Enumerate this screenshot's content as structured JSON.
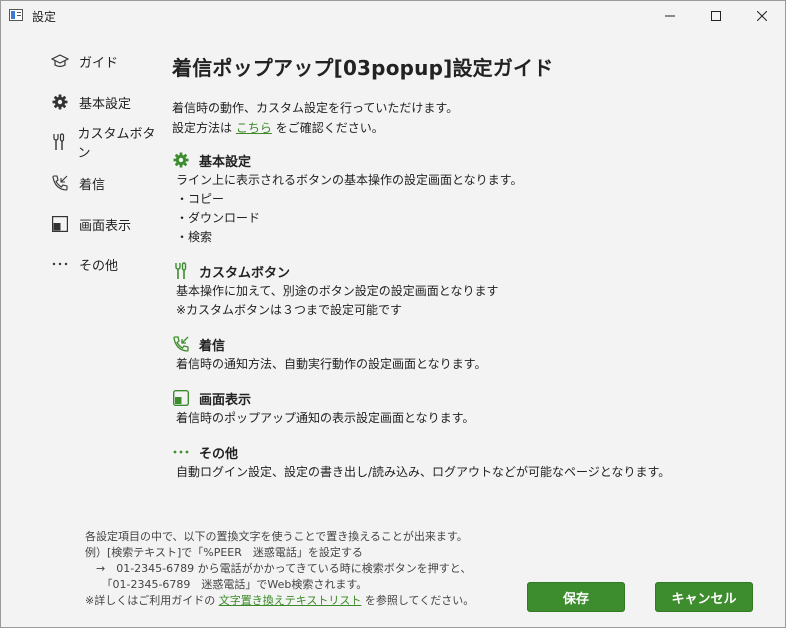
{
  "window": {
    "title": "設定"
  },
  "sidebar": {
    "items": [
      {
        "label": "ガイド",
        "icon": "graduation-cap-icon"
      },
      {
        "label": "基本設定",
        "icon": "gear-icon"
      },
      {
        "label": "カスタムボタン",
        "icon": "tools-icon"
      },
      {
        "label": "着信",
        "icon": "phone-incoming-icon"
      },
      {
        "label": "画面表示",
        "icon": "display-icon"
      },
      {
        "label": "その他",
        "icon": "more-icon"
      }
    ]
  },
  "main": {
    "title": "着信ポップアップ[03popup]設定ガイド",
    "intro_line1": "着信時の動作、カスタム設定を行っていただけます。",
    "intro_line2_prefix": "設定方法は",
    "intro_link": "こちら",
    "intro_line2_suffix": "をご確認ください。",
    "sections": [
      {
        "title": "基本設定",
        "icon": "gear-icon",
        "lines": [
          "ライン上に表示されるボタンの基本操作の設定画面となります。",
          "・コピー",
          "・ダウンロード",
          "・検索"
        ]
      },
      {
        "title": "カスタムボタン",
        "icon": "tools-icon",
        "lines": [
          "基本操作に加えて、別途のボタン設定の設定画面となります",
          "※カスタムボタンは３つまで設定可能です"
        ]
      },
      {
        "title": "着信",
        "icon": "phone-incoming-icon",
        "lines": [
          "着信時の通知方法、自動実行動作の設定画面となります。"
        ]
      },
      {
        "title": "画面表示",
        "icon": "display-icon",
        "lines": [
          "着信時のポップアップ通知の表示設定画面となります。"
        ]
      },
      {
        "title": "その他",
        "icon": "more-icon",
        "lines": [
          "自動ログイン設定、設定の書き出し/読み込み、ログアウトなどが可能なページとなります。"
        ]
      }
    ]
  },
  "footer": {
    "note_line1": "各設定項目の中で、以下の置換文字を使うことで置き換えることが出来ます。",
    "note_line2": "例）[検索テキスト]で「%PEER　迷惑電話」を設定する",
    "note_line3": "　→　01-2345-6789 から電話がかかってきている時に検索ボタンを押すと、",
    "note_line4": "　　「01-2345-6789　迷惑電話」でWeb検索されます。",
    "note_line5_prefix": "※詳しくはご利用ガイドの",
    "note_link": "文字置き換えテキストリスト",
    "note_line5_suffix": "を参照してください。",
    "save_label": "保存",
    "cancel_label": "キャンセル"
  },
  "colors": {
    "accent": "#3d8c2e",
    "link": "#3a8a27"
  }
}
